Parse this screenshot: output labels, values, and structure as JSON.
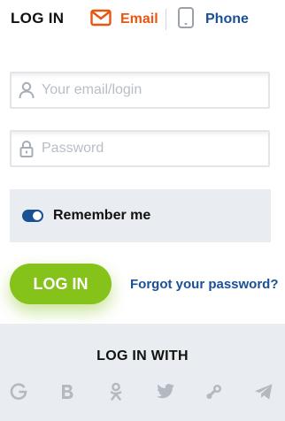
{
  "header": {
    "title": "LOG IN",
    "tabs": [
      {
        "label": "Email",
        "active": true,
        "icon": "envelope-icon",
        "color": "#e8560f"
      },
      {
        "label": "Phone",
        "active": false,
        "icon": "smartphone-icon",
        "color": "#1a5096"
      }
    ]
  },
  "form": {
    "email": {
      "placeholder": "Your email/login",
      "value": "",
      "icon": "user-icon"
    },
    "password": {
      "placeholder": "Password",
      "value": "",
      "icon": "lock-icon"
    },
    "remember": {
      "label": "Remember me",
      "checked": true
    },
    "login_button": "LOG IN",
    "forgot_link": "Forgot your password?"
  },
  "social": {
    "title": "LOG IN WITH",
    "icons": [
      "google-icon",
      "vk-icon",
      "odnoklassniki-icon",
      "twitter-icon",
      "steam-icon",
      "telegram-icon"
    ]
  },
  "colors": {
    "accent_orange": "#e8560f",
    "brand_blue": "#1a5096",
    "button_green": "#85c21a",
    "panel_gray": "#e9ecf0",
    "icon_gray": "#b3b9c1"
  }
}
